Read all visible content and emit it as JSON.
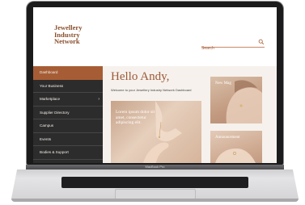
{
  "site": {
    "logo_lines": [
      "Jewellery",
      "Industry",
      "Network"
    ]
  },
  "search": {
    "placeholder": "Search"
  },
  "sidebar": {
    "items": [
      {
        "label": "Dashboard"
      },
      {
        "label": "Your Business"
      },
      {
        "label": "Marketplace"
      },
      {
        "label": "Supplier Directory"
      },
      {
        "label": "Campus"
      },
      {
        "label": "Events"
      },
      {
        "label": "Bodies & Support"
      }
    ],
    "marketplace_chevron": "›"
  },
  "main": {
    "greeting": "Hello Andy,",
    "welcome": "Welcome to your Jewellery Industry Network Dashboard",
    "hero_text": "Lorem ipsum dolor sit amet, consectetur adipiscing elit.",
    "cards": [
      {
        "title": "New Mag"
      },
      {
        "title": "Announcement"
      }
    ]
  },
  "device": {
    "label": "MacBook Pro"
  },
  "colors": {
    "accent": "#a65d35",
    "sidebar": "#2d2c2c",
    "logo": "#8a4f2d",
    "background": "#f6f1ec"
  }
}
